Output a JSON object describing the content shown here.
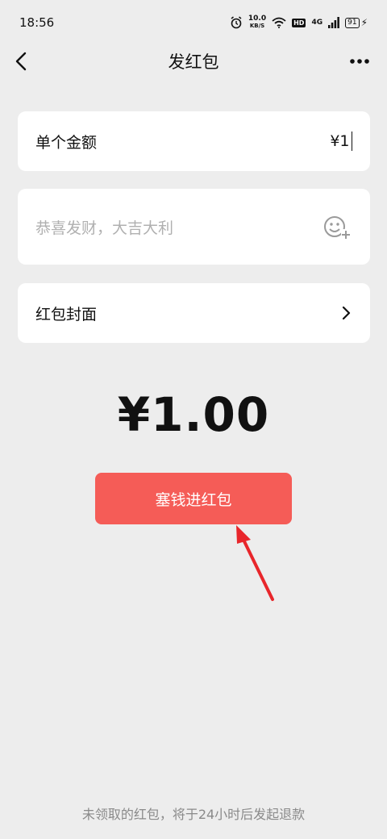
{
  "status_bar": {
    "time": "18:56",
    "net_speed_value": "10.0",
    "net_speed_unit": "KB/S",
    "hd_label": "HD",
    "network_label": "4G",
    "battery_level": "91"
  },
  "nav": {
    "title": "发红包"
  },
  "amount_field": {
    "label": "单个金额",
    "value": "¥1"
  },
  "message_field": {
    "placeholder": "恭喜发财，大吉大利"
  },
  "cover_row": {
    "label": "红包封面"
  },
  "total": {
    "amount": "¥1.00"
  },
  "submit": {
    "label": "塞钱进红包"
  },
  "footer": {
    "note": "未领取的红包，将于24小时后发起退款"
  },
  "colors": {
    "background": "#ededed",
    "button": "#f55c57",
    "annotation_arrow": "#e8262b"
  }
}
